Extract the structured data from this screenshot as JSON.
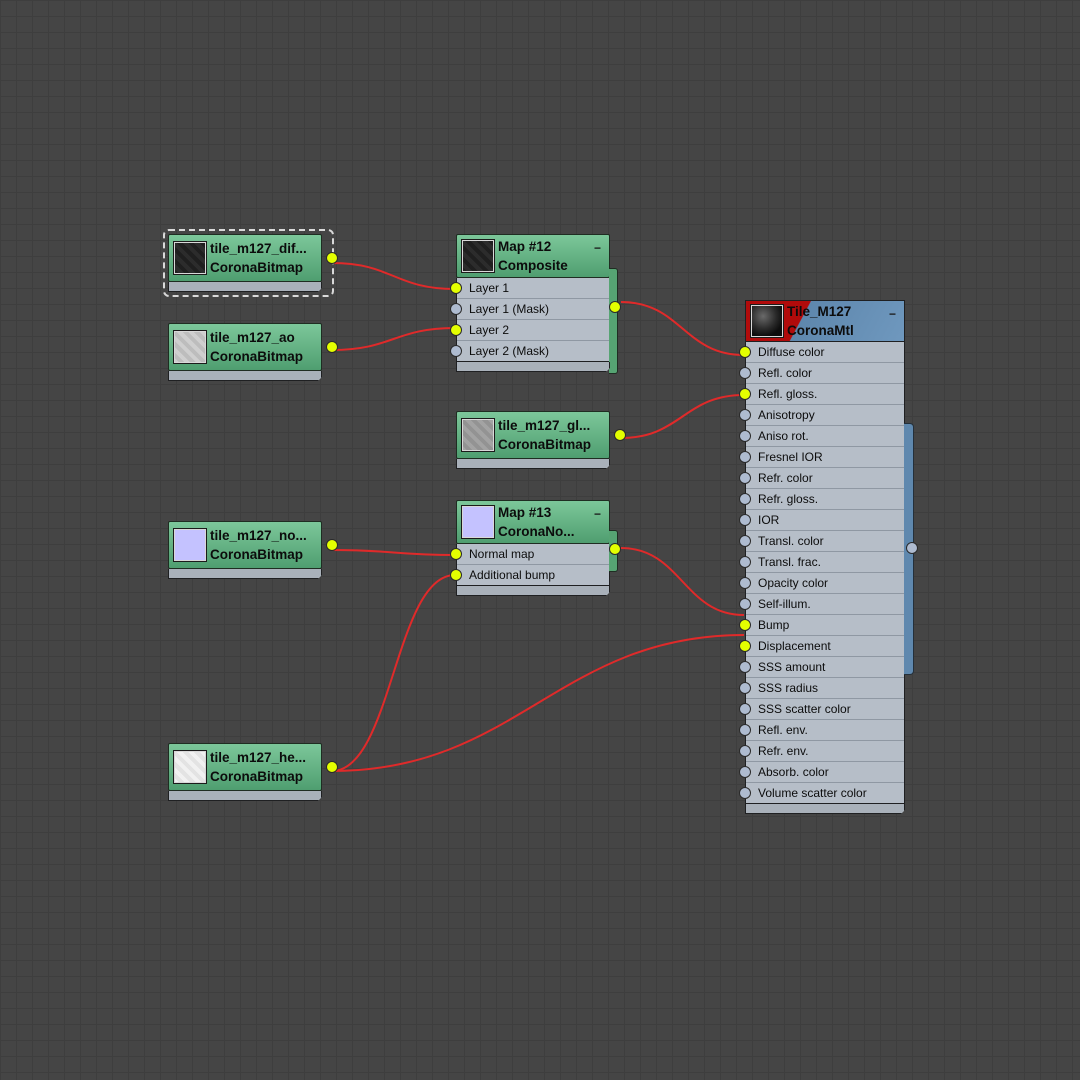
{
  "nodes": {
    "diff": {
      "name": "tile_m127_dif...",
      "type": "CoronaBitmap"
    },
    "ao": {
      "name": "tile_m127_ao",
      "type": "CoronaBitmap"
    },
    "composite": {
      "name": "Map #12",
      "type": "Composite",
      "minimize": "−",
      "slots": [
        "Layer 1",
        "Layer 1 (Mask)",
        "Layer 2",
        "Layer 2 (Mask)"
      ]
    },
    "gloss": {
      "name": "tile_m127_gl...",
      "type": "CoronaBitmap"
    },
    "normal_bmp": {
      "name": "tile_m127_no...",
      "type": "CoronaBitmap"
    },
    "normal_map": {
      "name": "Map #13",
      "type": "CoronaNo...",
      "minimize": "−",
      "slots": [
        "Normal map",
        "Additional bump"
      ]
    },
    "height": {
      "name": "tile_m127_he...",
      "type": "CoronaBitmap"
    },
    "material": {
      "name": "Tile_M127",
      "type": "CoronaMtl",
      "minimize": "−",
      "slots": [
        "Diffuse color",
        "Refl. color",
        "Refl. gloss.",
        "Anisotropy",
        "Aniso rot.",
        "Fresnel IOR",
        "Refr. color",
        "Refr. gloss.",
        "IOR",
        "Transl. color",
        "Transl. frac.",
        "Opacity color",
        "Self-illum.",
        "Bump",
        "Displacement",
        "SSS amount",
        "SSS radius",
        "SSS scatter color",
        "Refl. env.",
        "Refr. env.",
        "Absorb. color",
        "Volume scatter color"
      ]
    }
  },
  "connections": [
    {
      "from": "diff",
      "to": "composite",
      "slot": "Layer 1"
    },
    {
      "from": "ao",
      "to": "composite",
      "slot": "Layer 2"
    },
    {
      "from": "composite",
      "to": "material",
      "slot": "Diffuse color"
    },
    {
      "from": "gloss",
      "to": "material",
      "slot": "Refl. gloss."
    },
    {
      "from": "normal_bmp",
      "to": "normal_map",
      "slot": "Normal map"
    },
    {
      "from": "height",
      "to": "normal_map",
      "slot": "Additional bump"
    },
    {
      "from": "normal_map",
      "to": "material",
      "slot": "Bump"
    },
    {
      "from": "height",
      "to": "material",
      "slot": "Displacement"
    }
  ],
  "colors": {
    "wire": "#e02a2a",
    "port_connected": "#e4ff00",
    "port_empty": "#aebbd0",
    "map_node": "#5fae7e",
    "material_node": "#6f98be"
  }
}
